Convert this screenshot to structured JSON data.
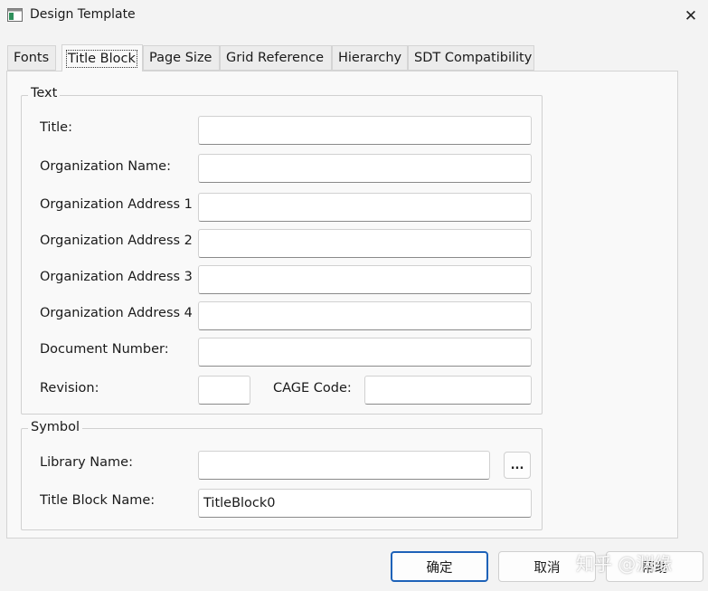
{
  "window": {
    "title": "Design Template",
    "close_glyph": "✕",
    "app_icon": "window-icon"
  },
  "tabs": [
    {
      "label": "Fonts",
      "active": false
    },
    {
      "label": "Title Block",
      "active": true
    },
    {
      "label": "Page Size",
      "active": false
    },
    {
      "label": "Grid Reference",
      "active": false
    },
    {
      "label": "Hierarchy",
      "active": false
    },
    {
      "label": "SDT Compatibility",
      "active": false
    }
  ],
  "text_group": {
    "title": "Text",
    "title_label": "Title:",
    "title_value": "",
    "org_name_label": "Organization Name:",
    "org_name_value": "",
    "org_address_1_label": "Organization Address 1",
    "org_address_1_value": "",
    "org_address_2_label": "Organization Address 2",
    "org_address_2_value": "",
    "org_address_3_label": "Organization Address 3",
    "org_address_3_value": "",
    "org_address_4_label": "Organization Address 4",
    "org_address_4_value": "",
    "doc_number_label": "Document Number:",
    "doc_number_value": "",
    "revision_label": "Revision:",
    "revision_value": "",
    "cage_code_label": "CAGE Code:",
    "cage_code_value": ""
  },
  "symbol_group": {
    "title": "Symbol",
    "library_name_label": "Library Name:",
    "library_name_value": "",
    "browse_label": "...",
    "title_block_name_label": "Title Block Name:",
    "title_block_name_value": "TitleBlock0"
  },
  "buttons": {
    "ok": "确定",
    "cancel": "取消",
    "help": "帮助"
  },
  "watermark": "知乎 @渊缘",
  "colors": {
    "default_button_border": "#1e62b8",
    "background": "#f3f3f3",
    "panel": "#f9f9f9"
  }
}
